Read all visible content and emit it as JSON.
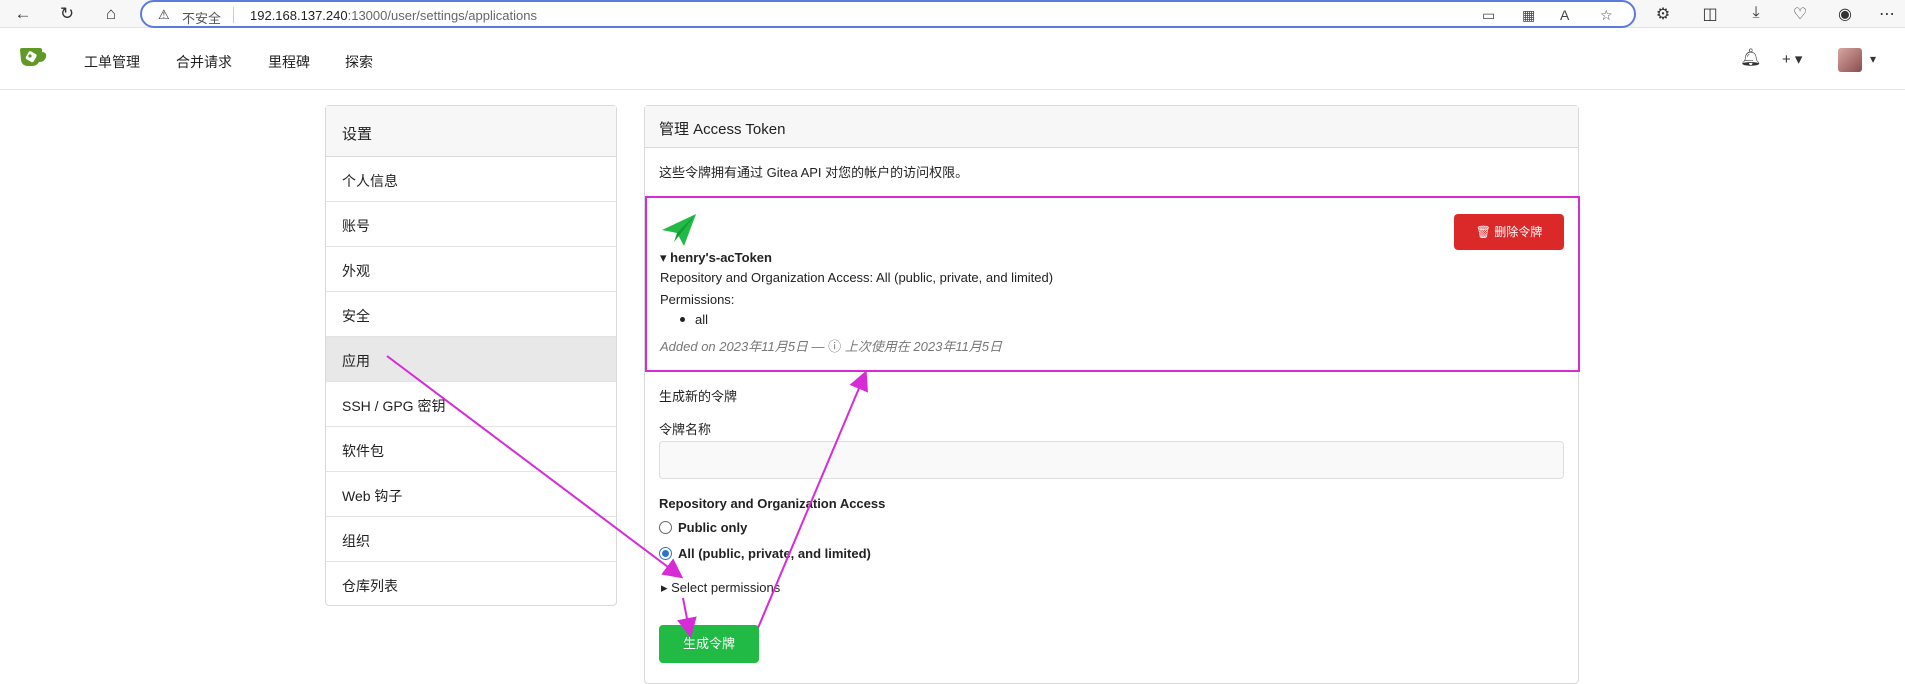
{
  "browser": {
    "warning": "不安全",
    "url_host": "192.168.137.240",
    "url_rest": ":13000/user/settings/applications"
  },
  "header": {
    "nav": [
      "工单管理",
      "合并请求",
      "里程碑",
      "探索"
    ],
    "plus": "+ ▾",
    "avatar_caret": "▾"
  },
  "sidebar": {
    "title": "设置",
    "items": [
      "个人信息",
      "账号",
      "外观",
      "安全",
      "应用",
      "SSH / GPG 密钥",
      "软件包",
      "Web 钩子",
      "组织",
      "仓库列表"
    ],
    "active_index": 4
  },
  "panel": {
    "title": "管理 Access Token",
    "description": "这些令牌拥有通过 Gitea API 对您的帐户的访问权限。",
    "token": {
      "name": "henry's-acToken",
      "access": "Repository and Organization Access: All (public, private, and limited)",
      "permissions_label": "Permissions:",
      "permission": "all",
      "added": "Added on 2023年11月5日 — ",
      "last_used": "上次使用在 2023年11月5日",
      "delete_label": "删除令牌"
    },
    "generate": {
      "title": "生成新的令牌",
      "name_label": "令牌名称",
      "name_value": "",
      "access_label": "Repository and Organization Access",
      "options": [
        "Public only",
        "All (public, private, and limited)"
      ],
      "selected_option": 1,
      "select_permissions": "Select permissions",
      "button_label": "生成令牌"
    }
  },
  "colors": {
    "accent_green": "#21ba45",
    "danger_red": "#db2828",
    "annotation_magenta": "#d62bd6",
    "radio_blue": "#2f74c0"
  }
}
